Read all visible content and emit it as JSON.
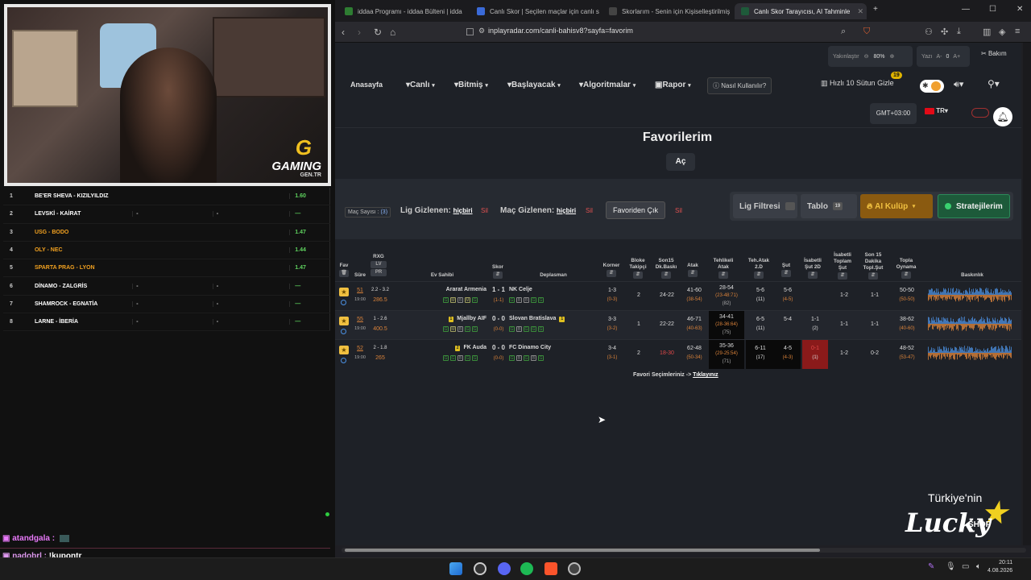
{
  "stream": {
    "logo_text": "GAMING",
    "logo_sub": "GEN.TR",
    "match_list": [
      {
        "n": "1",
        "teams": "BE'ER SHEVA - KIZILYILDIZ",
        "c1": "",
        "c2": "",
        "c3": "1.60",
        "color": "#ffffff"
      },
      {
        "n": "2",
        "teams": "LEVSKİ - KAİRAT",
        "c1": "-",
        "c2": "-",
        "c3": "—",
        "color": "#ffffff"
      },
      {
        "n": "3",
        "teams": "USG - BODO",
        "c1": "",
        "c2": "",
        "c3": "1.47",
        "color": "#f0a020"
      },
      {
        "n": "4",
        "teams": "OLY - NEC",
        "c1": "",
        "c2": "",
        "c3": "1.44",
        "color": "#f0a020"
      },
      {
        "n": "5",
        "teams": "SPARTA PRAG - LYON",
        "c1": "",
        "c2": "",
        "c3": "1.47",
        "color": "#f0a020"
      },
      {
        "n": "6",
        "teams": "DİNAMO - ZALGRİS",
        "c1": "-",
        "c2": "-",
        "c3": "—",
        "color": "#ffffff"
      },
      {
        "n": "7",
        "teams": "SHAMROCK - EGNATİA",
        "c1": "-",
        "c2": "-",
        "c3": "—",
        "color": "#ffffff"
      },
      {
        "n": "8",
        "teams": "LARNE - İBERİA",
        "c1": "-",
        "c2": "-",
        "c3": "—",
        "color": "#ffffff"
      }
    ],
    "chat": [
      {
        "user": "atandgala",
        "msg": ""
      },
      {
        "user": "nadobrl",
        "msg": "!kupontr"
      }
    ],
    "lucky_line1": "Türkiye'nin",
    "lucky_line2": "Lucky",
    "lucky_line3": "SHOP"
  },
  "browser": {
    "tabs": [
      {
        "label": "iddaa Programı - iddaa Bülteni | idda",
        "icon_color": "#2e7d32"
      },
      {
        "label": "Canlı Skor | Seçilen maçlar için canlı s",
        "icon_color": "#3a6ad8"
      },
      {
        "label": "Skorlarım - Senin için Kişiselleştirilmiş",
        "icon_color": "#444444"
      },
      {
        "label": "Canlı Skor Tarayıcısı, AI Tahminle",
        "icon_color": "#1e5a3a"
      }
    ],
    "url": "inplayradar.com/canli-bahisv8?sayfa=favorim"
  },
  "page": {
    "zoom_label": "Yakınlaştır",
    "zoom_value": "80%",
    "yaz_label": "Yazı",
    "yaz_minus": "A-",
    "yaz_value": "0",
    "yaz_plus": "A+",
    "bakim": "Bakım",
    "nav": {
      "home": "Anasayfa",
      "canli": "▾Canlı",
      "bitmis": "▾Bitmiş",
      "basliyacak": "▾Başlayacak",
      "algoritmalar": "▾Algoritmalar",
      "rapor": "Rapor",
      "howto": "Nasıl Kullanılır?",
      "hizli": "Hızlı 10 Sütun Gizle",
      "hizli_badge": "19"
    },
    "gmt": "GMT+03:00",
    "lang": "TR",
    "title": "Favorilerim",
    "ac_button": "Aç",
    "filters": {
      "mac_sayisi_label": "Maç Sayısı :",
      "mac_sayisi_value": "(3)",
      "lig_label": "Lig Gizlenen:",
      "lig_value": "hiçbiri",
      "mac_label": "Maç Gizlenen:",
      "mac_value": "hiçbiri",
      "sil": "Sil",
      "favoriden_cik": "Favoriden Çık",
      "lig_filtresi": "Lig Filtresi",
      "tablo": "Tablo",
      "tablo_count": "19",
      "ai_kulup": "AI Kulüp",
      "stratejilerim": "Stratejilerim"
    },
    "headers": {
      "fav": "Fav",
      "sure": "Süre",
      "rxg": "RXG",
      "lv": "LV",
      "pr": "PR",
      "ev": "Ev Sahibi",
      "skor": "Skor",
      "dep": "Deplasman",
      "korner": "Korner",
      "bloke": "Bloke Takipçi",
      "son15": "Son15 Dk.Baskı",
      "atak": "Atak",
      "tehlikeli": "Tehlikeli Atak",
      "tehatak2d": "Teh.Atak 2.D",
      "sut": "Şut",
      "isabetli2d": "İsabetli Şut 2D",
      "isabetlitop": "İsabetli Toplam Şut",
      "son15dk": "Son 15 Dakika Topl.Şut",
      "topla": "Topla Oynama",
      "baskinlik": "Baskınlık"
    },
    "matches": [
      {
        "minute": "51",
        "time": "19:00",
        "rxg": "2.2 - 3.2",
        "pr": "286.5",
        "home": "Ararat Armenia",
        "home_card": "",
        "score": "1 - 1",
        "ht": "(1-1)",
        "away": "NK Celje",
        "away_card": "",
        "home_form": [
          "G",
          "M",
          "B",
          "M",
          "G"
        ],
        "away_form": [
          "G",
          "B",
          "B",
          "G",
          "G"
        ],
        "corner": "1-3",
        "corner_ht": "(0-3)",
        "bloke": "2",
        "son15": "24-22",
        "atak": "41-60",
        "atak_ht": "(38-54)",
        "teh": "28-54",
        "teh_sub": "(23-48:71)",
        "teh_sub2": "(82)",
        "teh2d": "5-6",
        "teh2d_sub": "(11)",
        "sut": "5-6",
        "sut_sub": "(4-5)",
        "isb2d": "",
        "isb2d_sub": "",
        "isbtop": "1-2",
        "son15sut": "1-1",
        "topla": "50-50",
        "topla_sub": "(50-50)"
      },
      {
        "minute": "55",
        "time": "19:00",
        "rxg": "1 - 2.6",
        "pr": "400.5",
        "home": "Mjallby AIF",
        "home_card": "1",
        "score": "0 - 0",
        "ht": "(0-0)",
        "away": "Slovan Bratislava",
        "away_card": "1",
        "home_form": [
          "G",
          "M",
          "B",
          "G",
          "G"
        ],
        "away_form": [
          "G",
          "B",
          "G",
          "G",
          "G"
        ],
        "corner": "3-3",
        "corner_ht": "(3-2)",
        "bloke": "1",
        "son15": "22-22",
        "atak": "46-71",
        "atak_ht": "(40-63)",
        "teh": "34-41",
        "teh_sub": "(28-36:64)",
        "teh_sub2": "(75)",
        "teh2d": "6-5",
        "teh2d_sub": "(11)",
        "sut": "5-4",
        "sut_sub": "",
        "isb2d": "1-1",
        "isb2d_sub": "(2)",
        "isbtop": "1-1",
        "son15sut": "1-1",
        "topla": "38-62",
        "topla_sub": "(40-60)"
      },
      {
        "minute": "52",
        "time": "19:00",
        "rxg": "2 - 1.8",
        "pr": "265",
        "home": "FK Auda",
        "home_card": "2",
        "score": "0 - 0",
        "ht": "(0-0)",
        "away": "FC Dinamo City",
        "away_card": "",
        "home_form": [
          "G",
          "G",
          "B",
          "G",
          "G"
        ],
        "away_form": [
          "G",
          "B",
          "G",
          "B",
          "G"
        ],
        "corner": "3-4",
        "corner_ht": "(3-1)",
        "bloke": "2",
        "son15": "18-30",
        "atak": "62-48",
        "atak_ht": "(50-34)",
        "teh": "35-36",
        "teh_sub": "(29-25:54)",
        "teh_sub2": "(71)",
        "teh2d": "6-11",
        "teh2d_sub": "(17)",
        "sut": "4-5",
        "sut_sub": "(4-3)",
        "isb2d": "0-1",
        "isb2d_sub": "(1)",
        "isbtop": "1-2",
        "son15sut": "0-2",
        "topla": "48-52",
        "topla_sub": "(53-47)"
      }
    ],
    "fav_note": "Favori Seçimleriniz ->",
    "fav_note_link": "Tıklayınız"
  },
  "taskbar": {
    "time": "20:11",
    "date": "4.08.2026"
  },
  "colors": {
    "accent_orange": "#d9823a",
    "star": "#f0c040",
    "highlight_red": "#8a1a1a"
  }
}
